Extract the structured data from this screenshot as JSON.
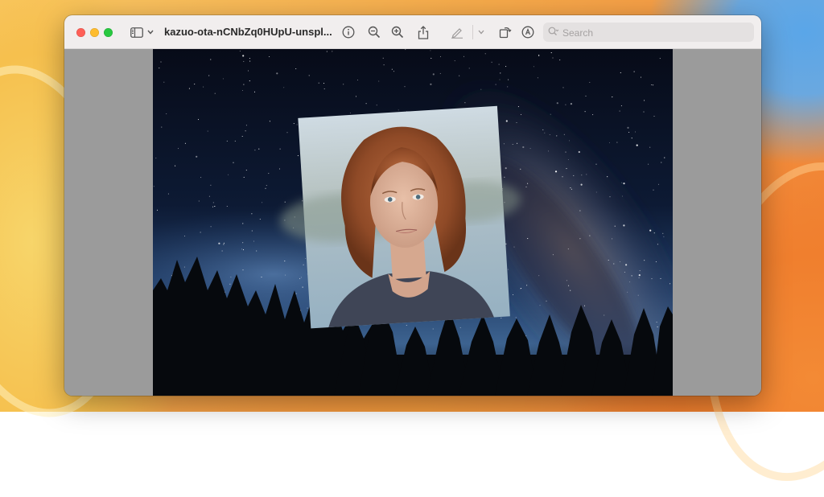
{
  "window": {
    "title": "kazuo-ota-nCNbZq0HUpU-unspl...",
    "search_placeholder": "Search"
  },
  "toolbar": {
    "icons": [
      "sidebar-icon",
      "chevron-down-icon",
      "info-icon",
      "zoom-out-icon",
      "zoom-in-icon",
      "share-icon",
      "markup-pen-icon",
      "chevron-down-icon",
      "rotate-icon",
      "annotate-icon",
      "search-icon"
    ]
  },
  "colors": {
    "close": "#fe5f57",
    "minimize": "#febc2e",
    "zoom": "#28c840",
    "titlebar": "#f1eeee",
    "content_bg": "#9b9b9b"
  }
}
